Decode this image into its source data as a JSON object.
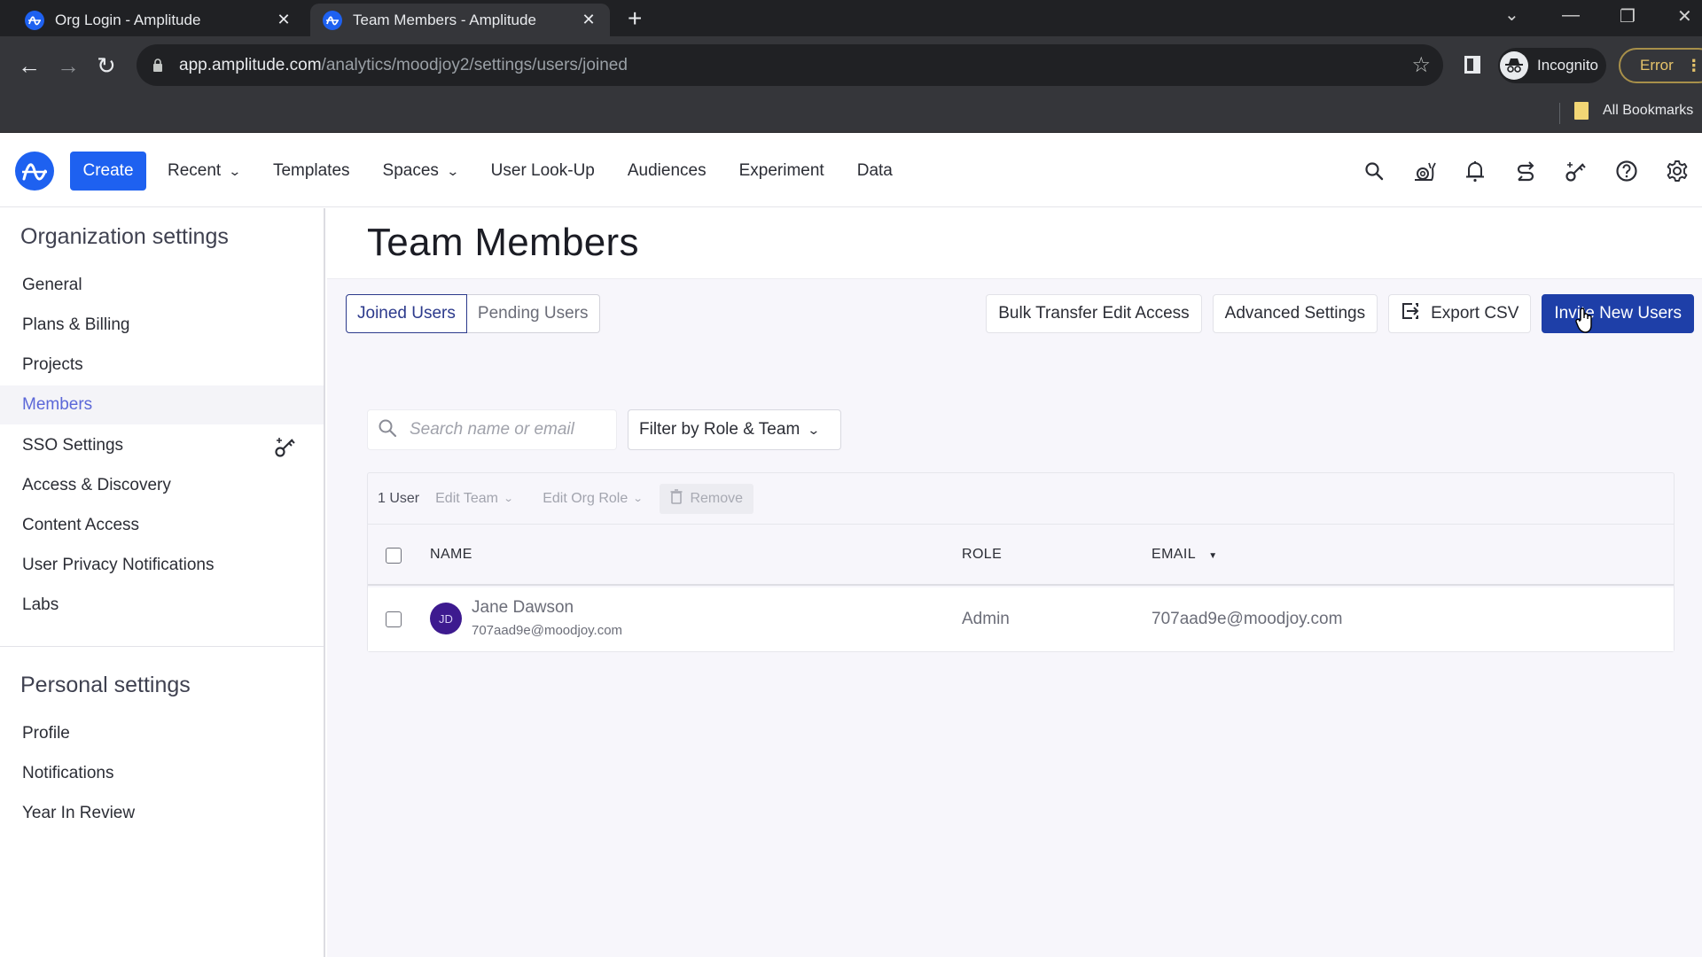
{
  "browser": {
    "tabs": [
      {
        "title": "Org Login - Amplitude",
        "active": false
      },
      {
        "title": "Team Members - Amplitude",
        "active": true
      }
    ],
    "url_host": "app.amplitude.com",
    "url_path": "/analytics/moodjoy2/settings/users/joined",
    "incognito_label": "Incognito",
    "error_label": "Error",
    "bookmarks_label": "All Bookmarks"
  },
  "appbar": {
    "create_label": "Create",
    "nav": [
      {
        "label": "Recent",
        "dropdown": true
      },
      {
        "label": "Templates",
        "dropdown": false
      },
      {
        "label": "Spaces",
        "dropdown": true
      },
      {
        "label": "User Look-Up",
        "dropdown": false
      },
      {
        "label": "Audiences",
        "dropdown": false
      },
      {
        "label": "Experiment",
        "dropdown": false
      },
      {
        "label": "Data",
        "dropdown": false
      }
    ],
    "icons": [
      "search-icon",
      "snail-icon",
      "bell-icon",
      "sync-arrows-icon",
      "key-sparkle-icon",
      "help-icon",
      "gear-icon"
    ],
    "brand_color": "#1E61F0"
  },
  "sidebar": {
    "org_heading": "Organization settings",
    "org_items": [
      {
        "label": "General"
      },
      {
        "label": "Plans & Billing"
      },
      {
        "label": "Projects"
      },
      {
        "label": "Members",
        "active": true
      },
      {
        "label": "SSO Settings",
        "icon": "key-sparkle-icon"
      },
      {
        "label": "Access & Discovery"
      },
      {
        "label": "Content Access"
      },
      {
        "label": "User Privacy Notifications"
      },
      {
        "label": "Labs"
      }
    ],
    "personal_heading": "Personal settings",
    "personal_items": [
      {
        "label": "Profile"
      },
      {
        "label": "Notifications"
      },
      {
        "label": "Year In Review"
      }
    ]
  },
  "main": {
    "title": "Team Members",
    "segments": [
      {
        "label": "Joined Users",
        "active": true
      },
      {
        "label": "Pending Users",
        "active": false
      }
    ],
    "actions": {
      "bulk_transfer": "Bulk Transfer Edit Access",
      "advanced": "Advanced Settings",
      "export": "Export CSV",
      "invite": "Invite New Users"
    },
    "search_placeholder": "Search name or email",
    "filter_label": "Filter by Role & Team",
    "bulk": {
      "count": "1 User",
      "edit_team": "Edit Team",
      "edit_role": "Edit Org Role",
      "remove": "Remove"
    },
    "table": {
      "columns": [
        "NAME",
        "ROLE",
        "EMAIL"
      ],
      "sort_column": "EMAIL",
      "rows": [
        {
          "initials": "JD",
          "name": "Jane Dawson",
          "sub_email": "707aad9e@moodjoy.com",
          "role": "Admin",
          "email": "707aad9e@moodjoy.com"
        }
      ]
    }
  }
}
